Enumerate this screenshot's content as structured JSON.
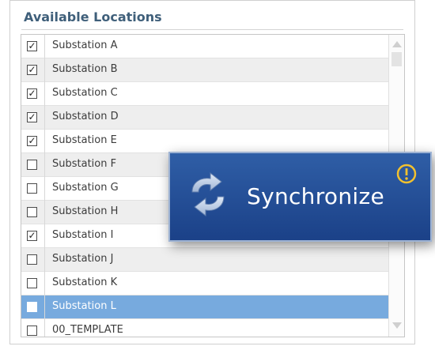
{
  "panel": {
    "title": "Available Locations"
  },
  "locations": [
    {
      "label": "Substation A",
      "checked": true
    },
    {
      "label": "Substation B",
      "checked": true
    },
    {
      "label": "Substation C",
      "checked": true
    },
    {
      "label": "Substation D",
      "checked": true
    },
    {
      "label": "Substation E",
      "checked": true
    },
    {
      "label": "Substation F",
      "checked": false
    },
    {
      "label": "Substation G",
      "checked": false
    },
    {
      "label": "Substation H",
      "checked": false
    },
    {
      "label": "Substation I",
      "checked": true
    },
    {
      "label": "Substation J",
      "checked": false
    },
    {
      "label": "Substation K",
      "checked": false
    },
    {
      "label": "Substation L",
      "checked": false,
      "selected": true
    },
    {
      "label": "00_TEMPLATE",
      "checked": false
    }
  ],
  "sync_button": {
    "label": "Synchronize",
    "icon": "sync-icon",
    "badge_icon": "warning-icon"
  },
  "colors": {
    "selected_row": "#77aade",
    "popup_bg": "#1f4a94",
    "warning": "#f2c12e"
  }
}
